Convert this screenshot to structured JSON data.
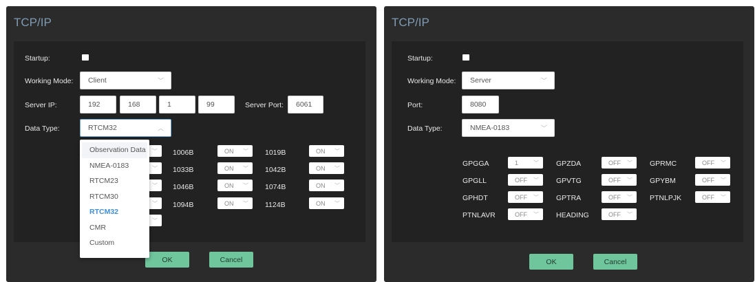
{
  "left_dialog": {
    "title": "TCP/IP",
    "startup_label": "Startup:",
    "working_mode_label": "Working Mode:",
    "working_mode_value": "Client",
    "server_ip_label": "Server IP:",
    "server_ip": [
      "192",
      "168",
      "1",
      "99"
    ],
    "server_port_label": "Server Port:",
    "server_port_value": "6061",
    "data_type_label": "Data Type:",
    "data_type_value": "RTCM32",
    "messages": [
      {
        "name": "1006B",
        "value": "ON"
      },
      {
        "name": "1019B",
        "value": "ON"
      },
      {
        "name": "1033B",
        "value": "ON"
      },
      {
        "name": "1042B",
        "value": "ON"
      },
      {
        "name": "1046B",
        "value": "ON"
      },
      {
        "name": "1074B",
        "value": "ON"
      },
      {
        "name": "1094B",
        "value": "ON"
      },
      {
        "name": "1124B",
        "value": "ON"
      }
    ],
    "dropdown_options": [
      "Observation Data",
      "NMEA-0183",
      "RTCM23",
      "RTCM30",
      "RTCM32",
      "CMR",
      "Custom"
    ],
    "dropdown_selected": "RTCM32",
    "ok_label": "OK",
    "cancel_label": "Cancel"
  },
  "right_dialog": {
    "title": "TCP/IP",
    "startup_label": "Startup:",
    "working_mode_label": "Working Mode:",
    "working_mode_value": "Server",
    "port_label": "Port:",
    "port_value": "8080",
    "data_type_label": "Data Type:",
    "data_type_value": "NMEA-0183",
    "messages": [
      {
        "name": "GPGGA",
        "value": "1"
      },
      {
        "name": "GPZDA",
        "value": "OFF"
      },
      {
        "name": "GPRMC",
        "value": "OFF"
      },
      {
        "name": "GPGLL",
        "value": "OFF"
      },
      {
        "name": "GPVTG",
        "value": "OFF"
      },
      {
        "name": "GPYBM",
        "value": "OFF"
      },
      {
        "name": "GPHDT",
        "value": "OFF"
      },
      {
        "name": "GPTRA",
        "value": "OFF"
      },
      {
        "name": "PTNLPJK",
        "value": "OFF"
      },
      {
        "name": "PTNLAVR",
        "value": "OFF"
      },
      {
        "name": "HEADING",
        "value": "OFF"
      }
    ],
    "ok_label": "OK",
    "cancel_label": "Cancel"
  },
  "icons": {
    "chevron_down": "chevron-down-icon",
    "chevron_up": "chevron-up-icon"
  },
  "colors": {
    "dialog_bg": "#2b2b2b",
    "panel_bg": "#222222",
    "title": "#7f9bb3",
    "button": "#6fc59c",
    "selected_option": "#3f8fd6"
  }
}
